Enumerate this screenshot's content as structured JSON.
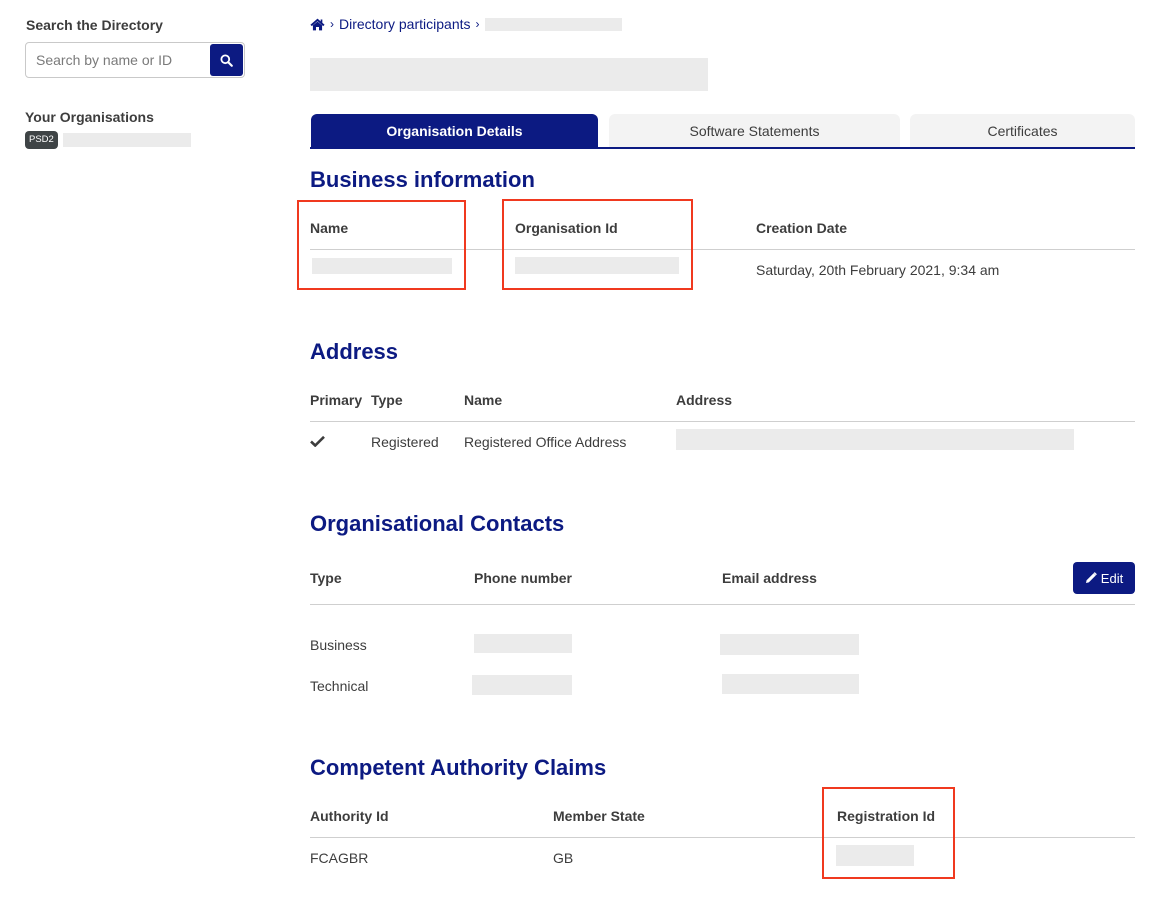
{
  "sidebar": {
    "search_title": "Search the Directory",
    "search_placeholder": "Search by name or ID",
    "search_value": "",
    "search_icon": "search-icon",
    "orgs_title": "Your Organisations",
    "organisations": [
      {
        "badge": "PSD2",
        "name": "[redacted]"
      }
    ]
  },
  "breadcrumb": {
    "home_icon": "home-icon",
    "items": [
      "Directory participants",
      "[redacted]"
    ]
  },
  "page_title": "[redacted]",
  "tabs": [
    {
      "label": "Organisation Details",
      "active": true
    },
    {
      "label": "Software Statements",
      "active": false
    },
    {
      "label": "Certificates",
      "active": false
    }
  ],
  "business_information": {
    "title": "Business information",
    "columns": [
      "Name",
      "Organisation Id",
      "Creation Date"
    ],
    "row": {
      "name": "[redacted]",
      "organisation_id": "[redacted]",
      "creation_date": "Saturday, 20th February 2021, 9:34 am"
    }
  },
  "address": {
    "title": "Address",
    "columns": [
      "Primary",
      "Type",
      "Name",
      "Address"
    ],
    "rows": [
      {
        "primary": true,
        "primary_icon": "check-icon",
        "type": "Registered",
        "name": "Registered Office Address",
        "address": "[redacted]"
      }
    ]
  },
  "contacts": {
    "title": "Organisational Contacts",
    "columns": [
      "Type",
      "Phone number",
      "Email address"
    ],
    "edit_label": "Edit",
    "edit_icon": "pencil-icon",
    "rows": [
      {
        "type": "Business",
        "phone": "[redacted]",
        "email": "[redacted]"
      },
      {
        "type": "Technical",
        "phone": "[redacted]",
        "email": "[redacted]"
      }
    ]
  },
  "authority_claims": {
    "title": "Competent Authority Claims",
    "columns": [
      "Authority Id",
      "Member State",
      "Registration Id"
    ],
    "rows": [
      {
        "authority_id": "FCAGBR",
        "member_state": "GB",
        "registration_id": "[redacted]"
      }
    ]
  },
  "colors": {
    "brand": "#0c1a82",
    "highlight": "#f0391f",
    "redaction": "#ebebeb",
    "badge": "#3f4446"
  }
}
